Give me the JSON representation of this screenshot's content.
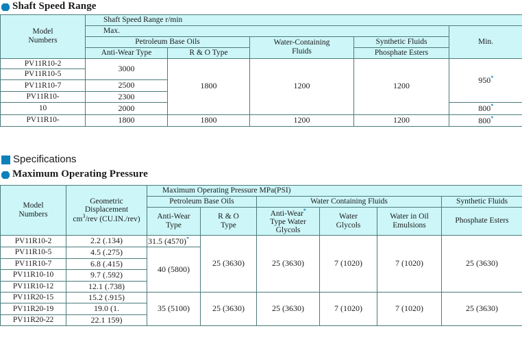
{
  "sections": {
    "shaft_speed_title": "Shaft Speed Range",
    "specifications_title": "Specifications",
    "max_pressure_title": "Maximum  Operating Pressure"
  },
  "table1": {
    "title": "Shaft Speed Range   r/min",
    "max_label": "Max.",
    "min_label": "Min.",
    "model_label_line1": "Model",
    "model_label_line2": "Numbers",
    "group_petroleum": "Petroleum Base Oils",
    "group_water": "Water-Containing Fluids",
    "group_water_line1": "Water-Containing",
    "group_water_line2": "Fluids",
    "group_synthetic": "Synthetic Fluids",
    "sub_antiwear": "Anti-Wear Type",
    "sub_ro": "R & O Type",
    "sub_phosphate": "Phosphate Esters",
    "rows": [
      {
        "model": "PV11R10-2",
        "antiwear": "3000"
      },
      {
        "model": "PV11R10-5",
        "antiwear": ""
      },
      {
        "model": "PV11R10-7",
        "antiwear": "2500"
      },
      {
        "model": "PV11R10-",
        "antiwear": "2300"
      },
      {
        "model": "10",
        "antiwear": "2000"
      }
    ],
    "group1_ro": "1800",
    "group1_water": "1200",
    "group1_synthetic": "1200",
    "group1_min_a": "950",
    "group1_min_b": "800",
    "last_row": {
      "model": "PV11R10-",
      "antiwear": "1800",
      "ro": "1800",
      "water": "1200",
      "synthetic": "1200",
      "min": "800"
    },
    "footnote_mark": "*"
  },
  "table2": {
    "title": "Maximum Operating Pressure   MPa(PSI)",
    "model_label_line1": "Model",
    "model_label_line2": "Numbers",
    "geo_line1": "Geometric",
    "geo_line2": "Displacement",
    "geo_line3_pre": "cm",
    "geo_line3_sup": "3",
    "geo_line3_post": "/rev (CU.IN./rev)",
    "group_petroleum": "Petroleum Base Oils",
    "group_water_containing": "Water Containing Fluids",
    "group_synthetic": "Synthetic Fluids",
    "sub_antiwear_l1": "Anti-Wear",
    "sub_antiwear_l2": "Type",
    "sub_ro_l1": "R & O",
    "sub_ro_l2": "Type",
    "sub_awwg_l1": "Anti-Wear",
    "sub_awwg_l2": "Type Water",
    "sub_awwg_l3": "Glycols",
    "sub_wg_l1": "Water",
    "sub_wg_l2": "Glycols",
    "sub_wio_l1": "Water in Oil",
    "sub_wio_l2": "Emulsions",
    "sub_phosphate": "Phosphate Esters",
    "rows": [
      {
        "model": "PV11R10-2",
        "disp": "2.2   (.134)"
      },
      {
        "model": "PV11R10-5",
        "disp": "4.5   (.275)"
      },
      {
        "model": "PV11R10-7",
        "disp": "6.8   (.415)"
      },
      {
        "model": "PV11R10-10",
        "disp": "9.7   (.592)"
      },
      {
        "model": "PV11R10-12",
        "disp": "12.1 (.738)"
      },
      {
        "model": "PV11R20-15",
        "disp": "15.2 (.915)"
      },
      {
        "model": "PV11R20-19",
        "disp": "19.0    (1."
      },
      {
        "model": "PV11R20-22",
        "disp": "22.1   159)"
      }
    ],
    "group_a": {
      "antiwear_top": "31.5 (4570)",
      "antiwear_rest": "40 (5800)",
      "ro": "25 (3630)",
      "awwg": "25 (3630)",
      "wg": "7 (1020)",
      "wio": "7 (1020)",
      "phosphate": "25 (3630)"
    },
    "group_b": {
      "antiwear": "35 (5100)",
      "ro": "25 (3630)",
      "awwg": "25 (3630)",
      "wg": "7 (1020)",
      "wio": "7 (1020)",
      "phosphate": "25 (3630)"
    },
    "footnote_mark": "*"
  },
  "colors": {
    "accent_blue": "#0d80ba",
    "header_bg": "#cdf6f8",
    "footnote_blue": "#1a82c4",
    "grid": "#4a7a7a",
    "outer_border": "#111111"
  }
}
